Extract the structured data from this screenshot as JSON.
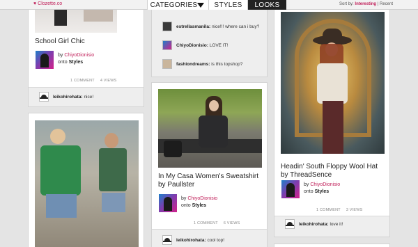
{
  "header": {
    "brand": "Clozette",
    "brand_suffix": ".co",
    "tabs": {
      "categories": "CATEGORIES",
      "styles": "STYLES",
      "looks": "LOOKS"
    },
    "sort_prefix": "Sort by:",
    "sort_active": "Interesting",
    "sort_sep": "|",
    "sort_other": "Recent"
  },
  "cards": {
    "school_girl": {
      "title": "School Girl Chic",
      "by": "by",
      "user": "ChiyoDionisio",
      "onto": "onto",
      "board": "Styles",
      "comments": "1 COMMENT",
      "views": "4 VIEWS",
      "comment": {
        "user": "leikohirohata:",
        "text": "nice!"
      }
    },
    "comments_card": {
      "comments": [
        {
          "user": "estrellasmanila:",
          "text": "nice!!! where can i buy?"
        },
        {
          "user": "ChiyoDionisio:",
          "text": "LOVE IT!"
        },
        {
          "user": "fashiondreams:",
          "text": "is this topshop?"
        }
      ]
    },
    "sweatshirt": {
      "title": "In My Casa Women's Sweatshirt by Paullster",
      "by": "by",
      "user": "ChiyoDionisio",
      "onto": "onto",
      "board": "Styles",
      "comments": "1 COMMENT",
      "views": "6 VIEWS",
      "comment": {
        "user": "leikohirohata:",
        "text": "cool top!"
      }
    },
    "floppy_hat": {
      "title": "Headin' South Floppy Wool Hat by ThreadSence",
      "by": "by",
      "user": "ChiyoDionisio",
      "onto": "onto",
      "board": "Styles",
      "comments": "1 COMMENT",
      "views": "3 VIEWS",
      "comment": {
        "user": "leikohirohata:",
        "text": "love it!"
      }
    }
  },
  "colors": {
    "accent": "#c0205a",
    "nav_active": "#222222"
  }
}
